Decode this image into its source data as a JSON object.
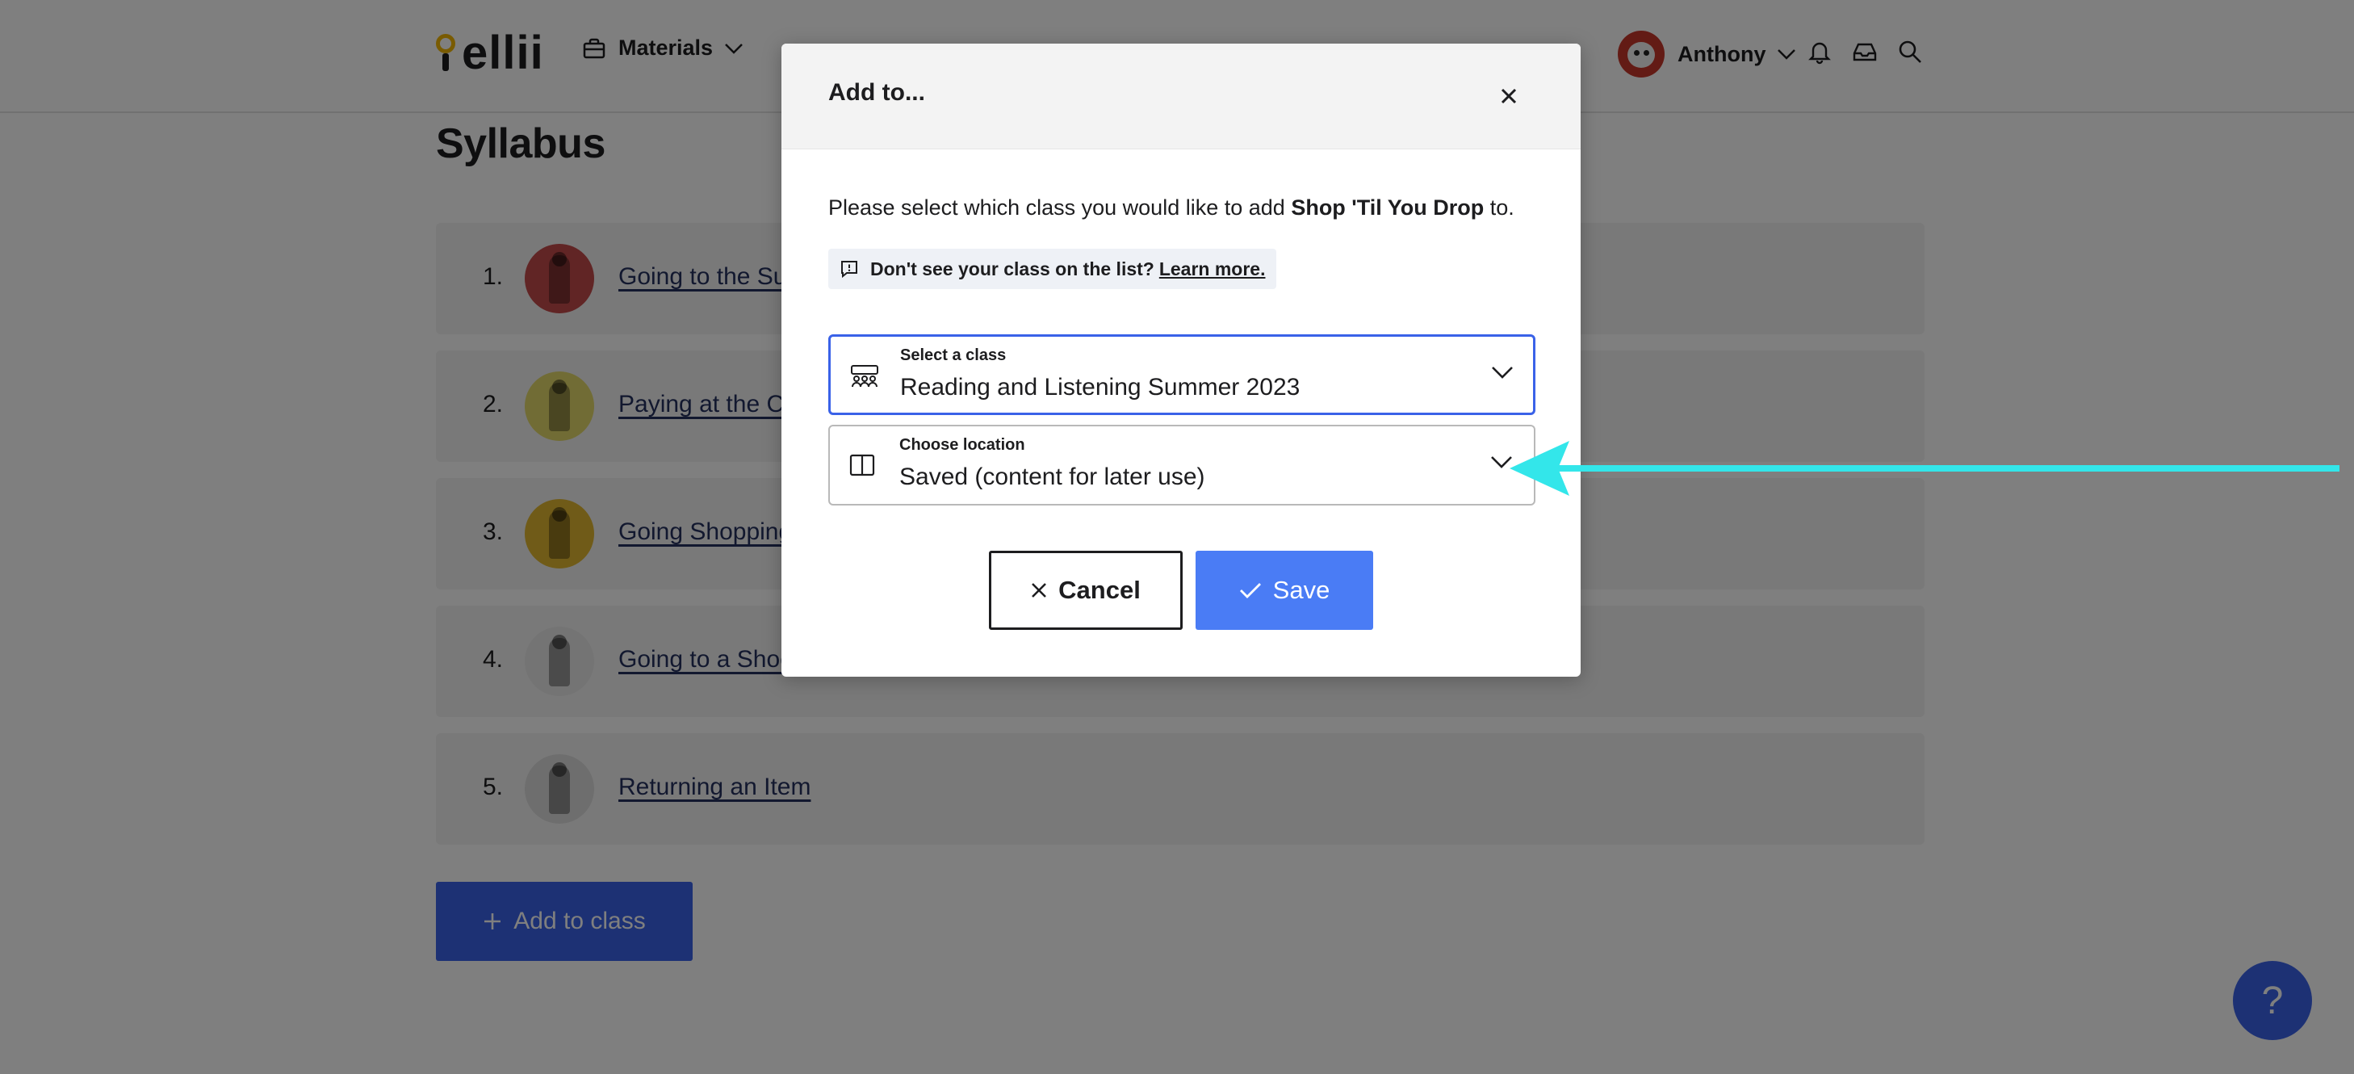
{
  "header": {
    "logo_text": "ellii",
    "nav_materials": "Materials",
    "user_name": "Anthony"
  },
  "page": {
    "title": "Syllabus",
    "items": [
      {
        "num": "1.",
        "title": "Going to the Su",
        "thumb_color": "#c24a4a"
      },
      {
        "num": "2.",
        "title": "Paying at the C",
        "thumb_color": "#e3d86a"
      },
      {
        "num": "3.",
        "title": "Going Shopping",
        "thumb_color": "#e0b630"
      },
      {
        "num": "4.",
        "title": "Going to a Shoe",
        "thumb_color": "#e8e8e8"
      },
      {
        "num": "5.",
        "title": "Returning an Item",
        "thumb_color": "#dcdcdc"
      }
    ],
    "add_to_class_label": "Add to class",
    "help_label": "?"
  },
  "modal": {
    "title": "Add to...",
    "prompt_prefix": "Please select which class you would like to add ",
    "prompt_material": "Shop 'Til You Drop",
    "prompt_suffix": " to.",
    "notice_text": "Don't see your class on the list?",
    "notice_link": "Learn more.",
    "class_field": {
      "label": "Select a class",
      "value": "Reading and Listening Summer 2023"
    },
    "location_field": {
      "label": "Choose location",
      "value": "Saved (content for later use)"
    },
    "cancel_label": "Cancel",
    "save_label": "Save"
  },
  "colors": {
    "accent": "#3a62e8",
    "save": "#4a7cf5",
    "annotation_arrow": "#33e6ea"
  }
}
